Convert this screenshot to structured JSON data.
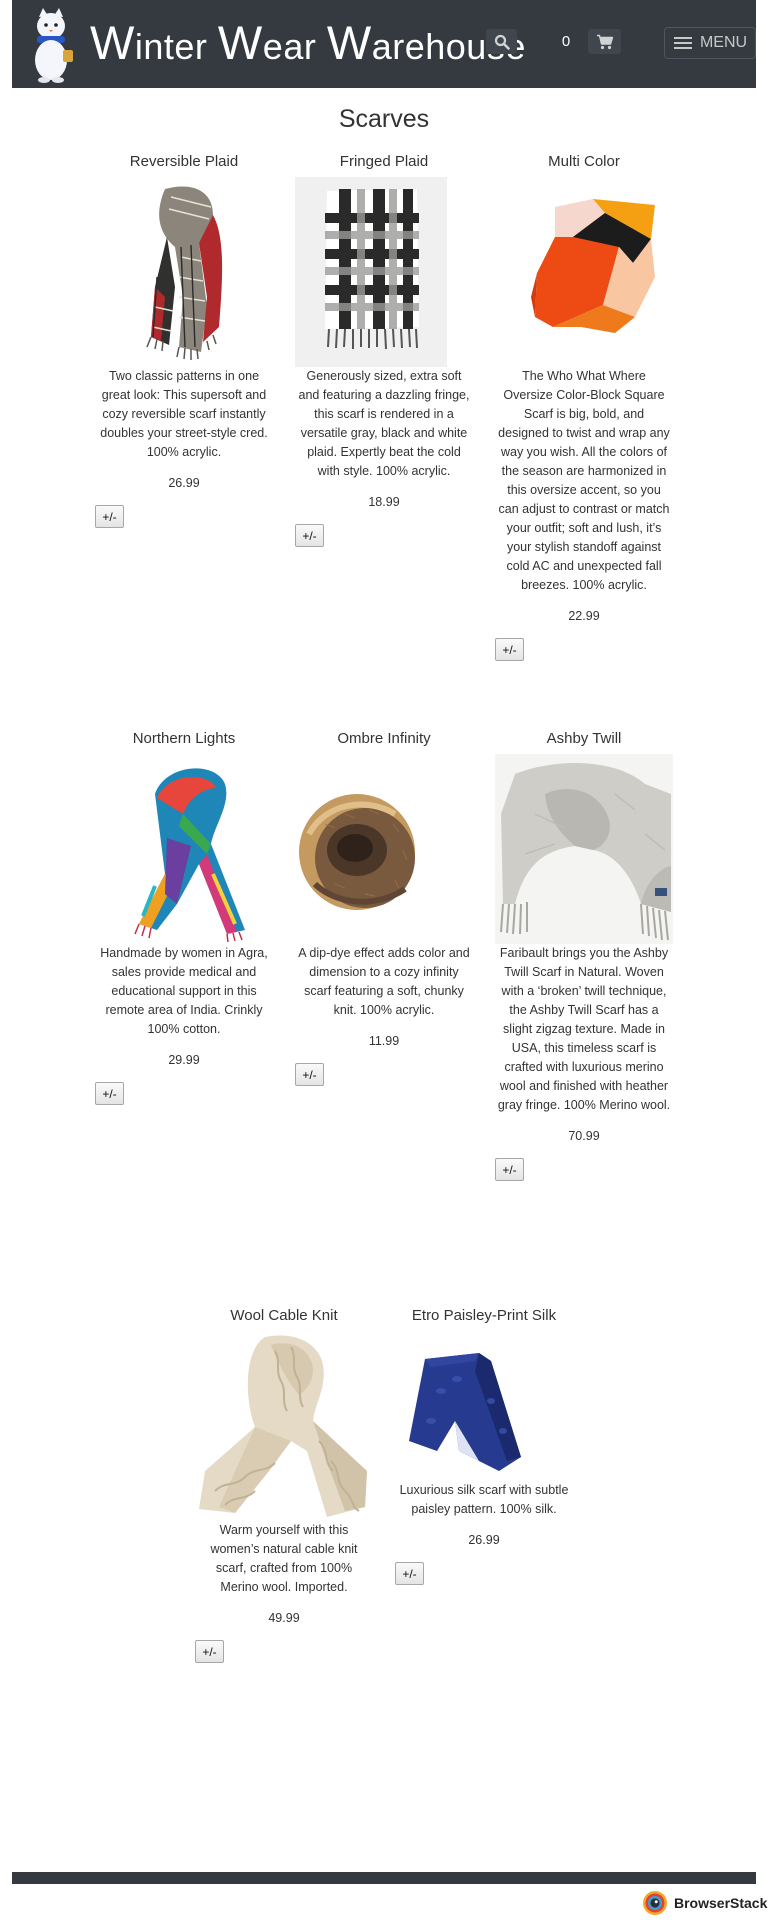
{
  "header": {
    "brand_parts": [
      "W",
      "inter ",
      "W",
      "ear ",
      "W",
      "arehouse"
    ],
    "cart_count": "0",
    "menu_label": "MENU",
    "colors": {
      "background": "#343a40",
      "text": "#ffffff"
    }
  },
  "page": {
    "title": "Scarves"
  },
  "products": [
    {
      "name": "Reversible Plaid",
      "description": "Two classic patterns in one great look: This supersoft and cozy reversible scarf instantly doubles your street-style cred. 100% acrylic.",
      "price": "26.99",
      "qty_label": "+/-"
    },
    {
      "name": "Fringed Plaid",
      "description": "Generously sized, extra soft and featuring a dazzling fringe, this scarf is rendered in a versatile gray, black and white plaid. Expertly beat the cold with style. 100% acrylic.",
      "price": "18.99",
      "qty_label": "+/-"
    },
    {
      "name": "Multi Color",
      "description": "The Who What Where Oversize Color-Block Square Scarf is big, bold, and designed to twist and wrap any way you wish. All the colors of the season are harmonized in this oversize accent, so you can adjust to contrast or match your outfit; soft and lush, it’s your stylish standoff against cold AC and unexpected fall breezes. 100% acrylic.",
      "price": "22.99",
      "qty_label": "+/-"
    },
    {
      "name": "Northern Lights",
      "description": "Handmade by women in Agra, sales provide medical and educational support in this remote area of India. Crinkly 100% cotton.",
      "price": "29.99",
      "qty_label": "+/-"
    },
    {
      "name": "Ombre Infinity",
      "description": "A dip-dye effect adds color and dimension to a cozy infinity scarf featuring a soft, chunky knit. 100% acrylic.",
      "price": "11.99",
      "qty_label": "+/-"
    },
    {
      "name": "Ashby Twill",
      "description": "Faribault brings you the Ashby Twill Scarf in Natural. Woven with a ‘broken’ twill technique, the Ashby Twill Scarf has a slight zigzag texture. Made in USA, this timeless scarf is crafted with luxurious merino wool and finished with heather gray fringe. 100% Merino wool.",
      "price": "70.99",
      "qty_label": "+/-"
    },
    {
      "name": "Wool Cable Knit",
      "description": "Warm yourself with this women’s natural cable knit scarf, crafted from 100% Merino wool. Imported.",
      "price": "49.99",
      "qty_label": "+/-"
    },
    {
      "name": "Etro Paisley-Print Silk",
      "description": "Luxurious silk scarf with subtle paisley pattern. 100% silk.",
      "price": "26.99",
      "qty_label": "+/-"
    }
  ],
  "footer": {
    "badge_text": "BrowserStack"
  }
}
